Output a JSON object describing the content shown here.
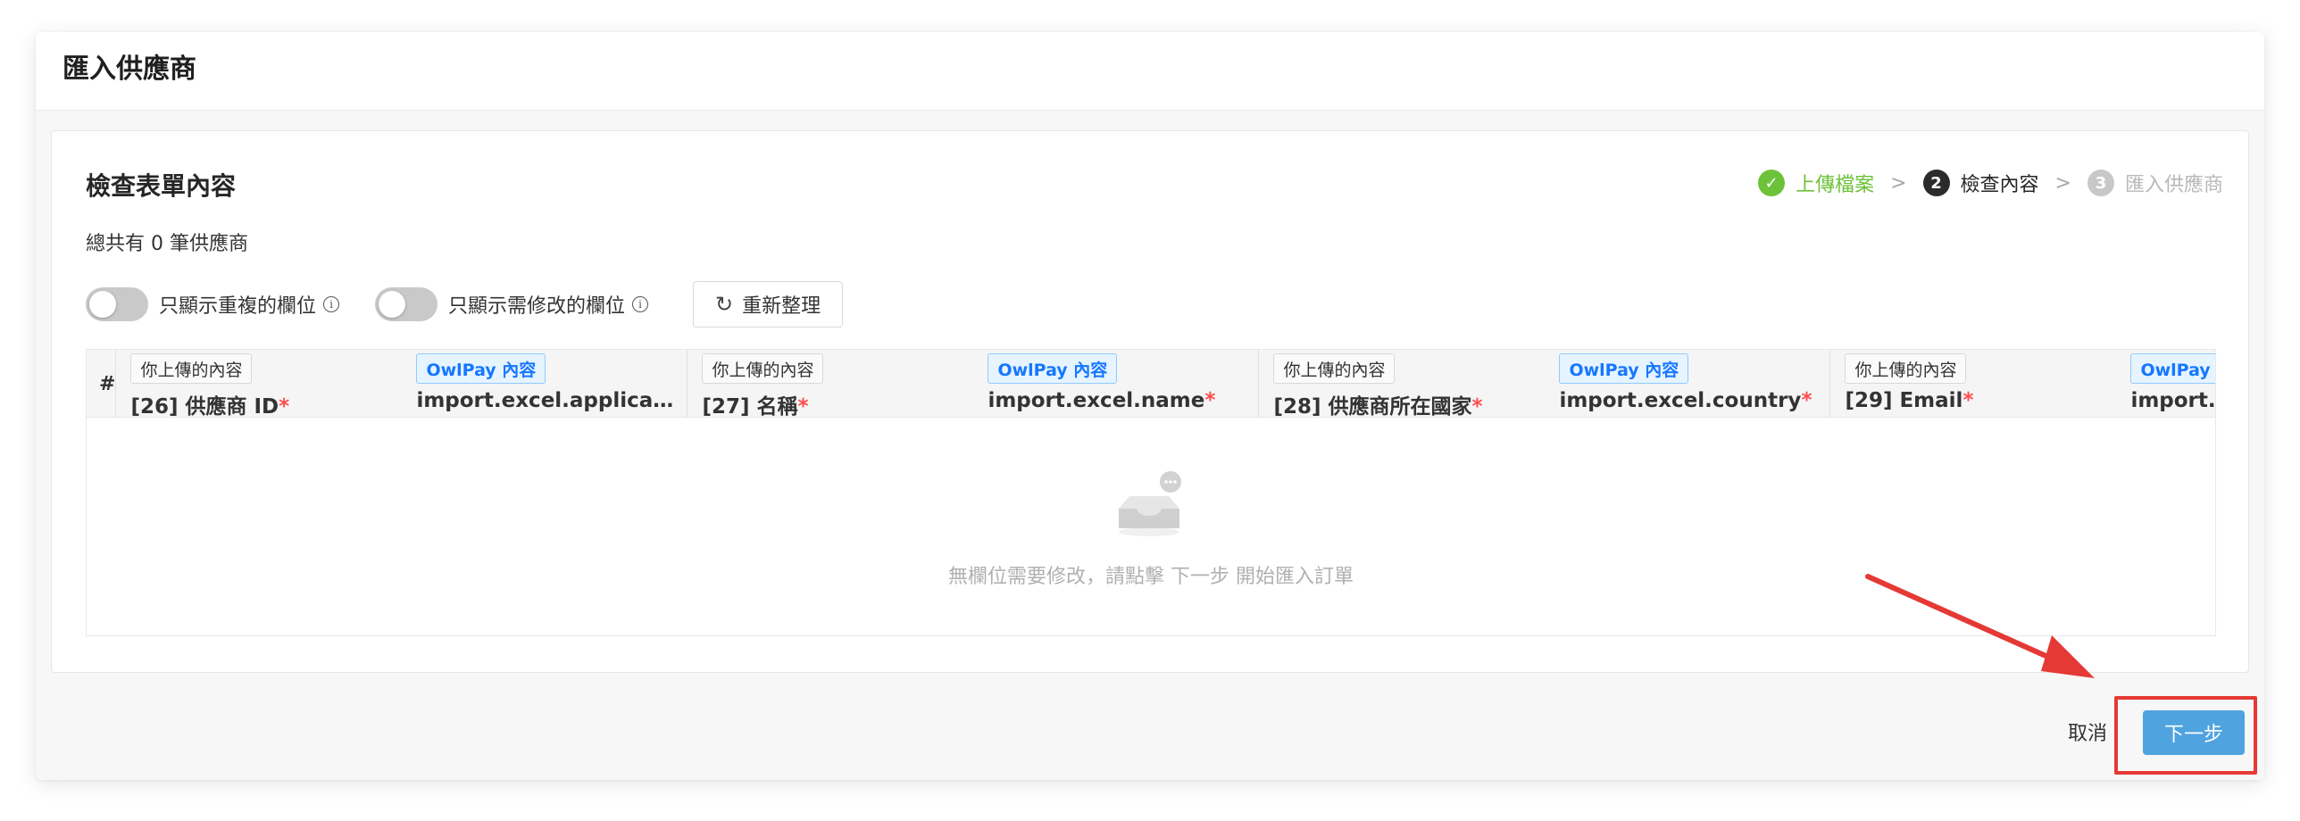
{
  "modal": {
    "title": "匯入供應商"
  },
  "card": {
    "title": "檢查表單內容",
    "summary": "總共有 0 筆供應商"
  },
  "steps": [
    {
      "number": "",
      "label": "上傳檔案",
      "status": "done",
      "icon": "check-icon"
    },
    {
      "number": "2",
      "label": "檢查內容",
      "status": "active"
    },
    {
      "number": "3",
      "label": "匯入供應商",
      "status": "wait"
    }
  ],
  "step_separator": ">",
  "controls": {
    "toggle_duplicates_label": "只顯示重複的欄位",
    "toggle_modify_label": "只顯示需修改的欄位",
    "toggle_duplicates_on": false,
    "toggle_modify_on": false,
    "refresh_label": "重新整理"
  },
  "table": {
    "hash_header": "#",
    "columns": [
      {
        "tag": "你上傳的內容",
        "tag_type": "upload",
        "name": "[26] 供應商 ID",
        "required": true
      },
      {
        "tag": "OwlPay 內容",
        "tag_type": "owlpay",
        "name": "import.excel.applicatio...",
        "required": false
      },
      {
        "tag": "你上傳的內容",
        "tag_type": "upload",
        "name": "[27] 名稱",
        "required": true
      },
      {
        "tag": "OwlPay 內容",
        "tag_type": "owlpay",
        "name": "import.excel.name",
        "required": true
      },
      {
        "tag": "你上傳的內容",
        "tag_type": "upload",
        "name": "[28] 供應商所在國家",
        "required": true
      },
      {
        "tag": "OwlPay 內容",
        "tag_type": "owlpay",
        "name": "import.excel.country",
        "required": true
      },
      {
        "tag": "你上傳的內容",
        "tag_type": "upload",
        "name": "[29] Email",
        "required": true
      },
      {
        "tag": "OwlPay 內容",
        "tag_type": "owlpay",
        "name": "import.excel.email",
        "required": false
      }
    ],
    "required_mark": "*",
    "empty_text": "無欄位需要修改，請點擊 下一步 開始匯入訂單"
  },
  "footer": {
    "cancel_label": "取消",
    "next_label": "下一步"
  },
  "colors": {
    "success": "#6ec23a",
    "primary": "#4fa3df",
    "annotation": "#e53935"
  }
}
